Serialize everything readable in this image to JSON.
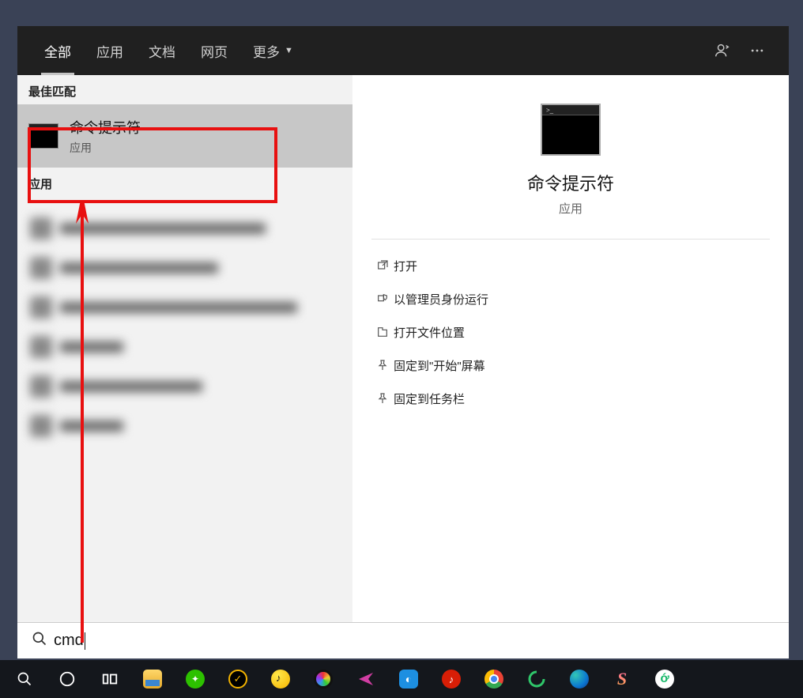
{
  "tabs": {
    "all": "全部",
    "apps": "应用",
    "documents": "文档",
    "web": "网页",
    "more": "更多"
  },
  "left": {
    "best_match_header": "最佳匹配",
    "best_match": {
      "title": "命令提示符",
      "subtitle": "应用"
    },
    "apps_header": "应用"
  },
  "preview": {
    "title": "命令提示符",
    "subtitle": "应用",
    "actions": [
      "打开",
      "以管理员身份运行",
      "打开文件位置",
      "固定到\"开始\"屏幕",
      "固定到任务栏"
    ]
  },
  "search": {
    "query": "cmd"
  },
  "icons": {
    "feedback": "feedback-person-icon",
    "more_menu": "more-icon",
    "open": "open-icon",
    "admin": "shield-icon",
    "folder": "folder-open-icon",
    "pin_start": "pin-icon",
    "pin_taskbar": "pin-icon",
    "search": "search-icon"
  }
}
